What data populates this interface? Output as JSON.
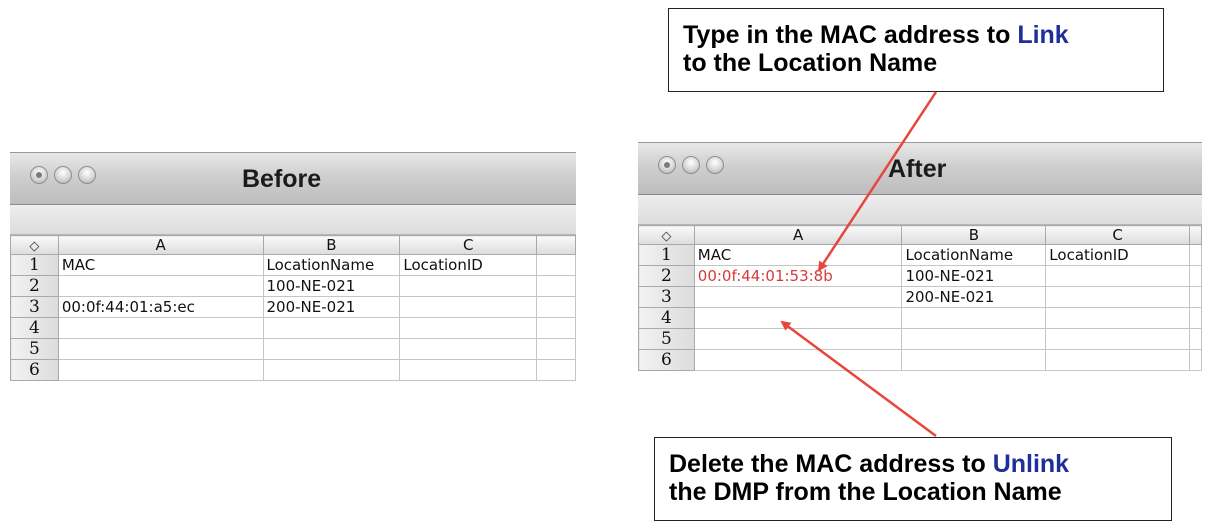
{
  "before": {
    "title": "Before",
    "columns": [
      "A",
      "B",
      "C"
    ],
    "corner_symbol": "◇",
    "rows": [
      {
        "n": "1",
        "cells": [
          "MAC",
          "LocationName",
          "LocationID",
          ""
        ]
      },
      {
        "n": "2",
        "cells": [
          "",
          "100-NE-021",
          "",
          ""
        ]
      },
      {
        "n": "3",
        "cells": [
          "00:0f:44:01:a5:ec",
          "200-NE-021",
          "",
          ""
        ]
      },
      {
        "n": "4",
        "cells": [
          "",
          "",
          "",
          ""
        ]
      },
      {
        "n": "5",
        "cells": [
          "",
          "",
          "",
          ""
        ]
      },
      {
        "n": "6",
        "cells": [
          "",
          "",
          "",
          ""
        ]
      }
    ]
  },
  "after": {
    "title": "After",
    "columns": [
      "A",
      "B",
      "C"
    ],
    "corner_symbol": "◇",
    "highlight_color": "#d63a3a",
    "rows": [
      {
        "n": "1",
        "cells": [
          "MAC",
          "LocationName",
          "LocationID",
          ""
        ]
      },
      {
        "n": "2",
        "cells": [
          "00:0f:44:01:53:8b",
          "100-NE-021",
          "",
          ""
        ]
      },
      {
        "n": "3",
        "cells": [
          "",
          "200-NE-021",
          "",
          ""
        ]
      },
      {
        "n": "4",
        "cells": [
          "",
          "",
          "",
          ""
        ]
      },
      {
        "n": "5",
        "cells": [
          "",
          "",
          "",
          ""
        ]
      },
      {
        "n": "6",
        "cells": [
          "",
          "",
          "",
          ""
        ]
      }
    ]
  },
  "callouts": {
    "top": {
      "line1": "Type in the MAC address to ",
      "link": "Link",
      "line2": "to the Location Name"
    },
    "bottom": {
      "line1": "Delete the MAC address to ",
      "link": "Unlink",
      "line2": "the DMP from the Location Name"
    },
    "highlight_color": "#1f2f9a",
    "arrow_color": "#e8463c"
  }
}
